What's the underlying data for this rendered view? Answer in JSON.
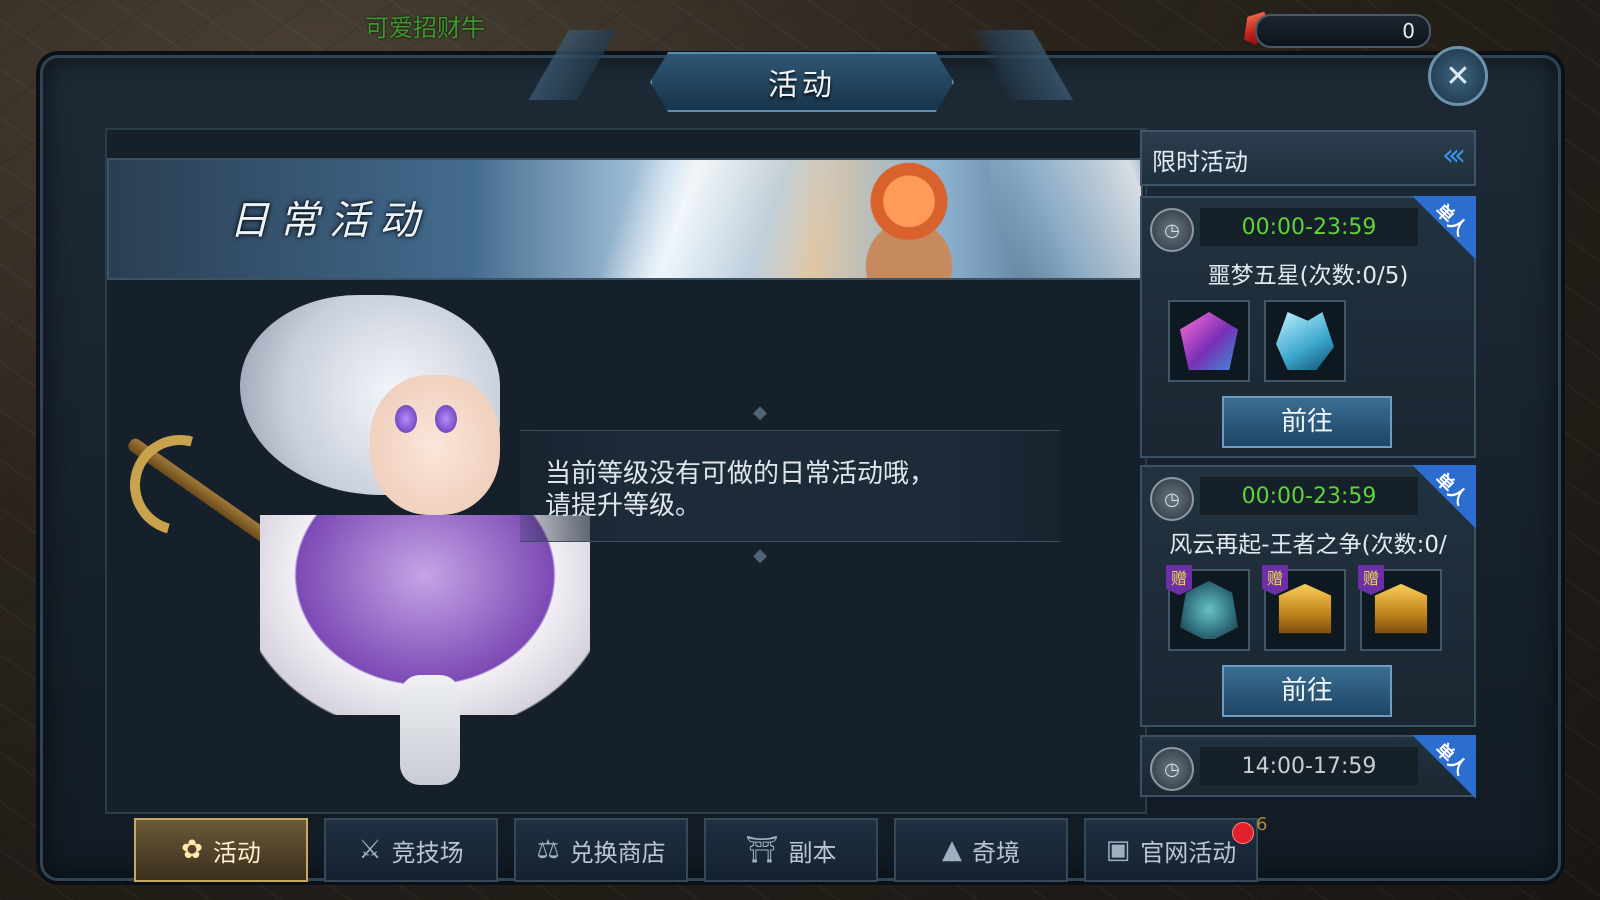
{
  "hud": {
    "player_name": "可爱招财牛",
    "currency_value": "0"
  },
  "window": {
    "title": "活动",
    "close_icon": "close-x-icon"
  },
  "banner": {
    "title": "日常活动"
  },
  "message": {
    "line1": "当前等级没有可做的日常活动哦，",
    "line2": "请提升等级。"
  },
  "limited": {
    "header": "限时活动",
    "collapse_icon": "‹‹‹",
    "cards": [
      {
        "time": "00:00-23:59",
        "time_color": "#5fd43a",
        "tag": "单人",
        "name": "噩梦五星(次数:0/5)",
        "button": "前往",
        "rewards": [
          {
            "icon": "pink-crystal-icon",
            "gift": ""
          },
          {
            "icon": "ice-crystal-icon",
            "gift": ""
          }
        ]
      },
      {
        "time": "00:00-23:59",
        "time_color": "#5fd43a",
        "tag": "单人",
        "name": "风云再起-王者之争(次数:0/",
        "button": "前往",
        "rewards": [
          {
            "icon": "helmet-icon",
            "gift": "赠"
          },
          {
            "icon": "treasure-chest-icon",
            "gift": "赠"
          },
          {
            "icon": "treasure-chest-icon",
            "gift": "赠"
          }
        ]
      },
      {
        "time": "14:00-17:59",
        "time_color": "#c7ced6",
        "tag": "单人"
      }
    ]
  },
  "tabs": [
    {
      "label": "活动",
      "icon": "flower-icon",
      "active": true
    },
    {
      "label": "竞技场",
      "icon": "crossed-swords-icon",
      "active": false
    },
    {
      "label": "兑换商店",
      "icon": "scale-icon",
      "active": false
    },
    {
      "label": "副本",
      "icon": "gate-icon",
      "active": false
    },
    {
      "label": "奇境",
      "icon": "mountain-icon",
      "active": false
    },
    {
      "label": "官网活动",
      "icon": "book-icon",
      "active": false
    }
  ],
  "notification_badge": "6"
}
